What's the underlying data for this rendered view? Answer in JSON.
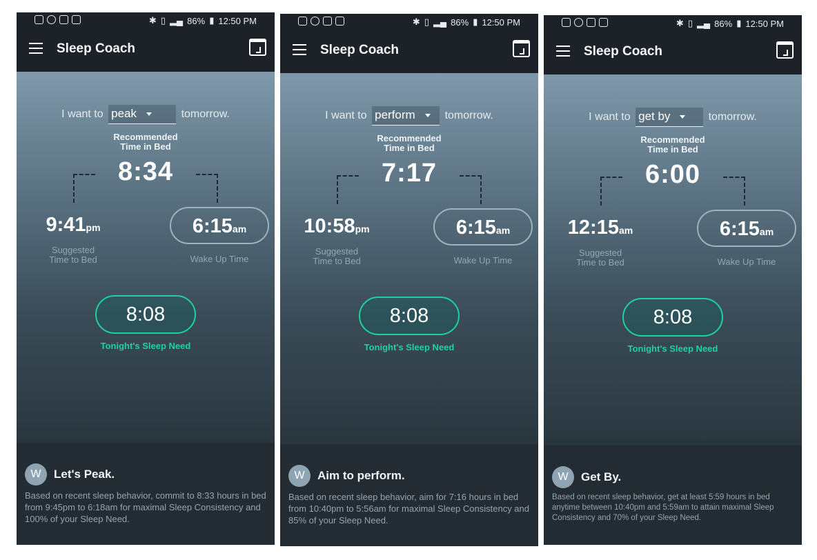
{
  "screens": [
    {
      "status": {
        "battery": "86%",
        "time": "12:50 PM"
      },
      "app_title": "Sleep Coach",
      "want_prefix": "I want to",
      "goal_selected": "peak",
      "want_suffix": "tomorrow.",
      "recommended_label_1": "Recommended",
      "recommended_label_2": "Time in Bed",
      "recommended_time": "8:34",
      "bedtime_value": "9:41",
      "bedtime_suffix": "pm",
      "bedtime_label_1": "Suggested",
      "bedtime_label_2": "Time to Bed",
      "wake_value": "6:15",
      "wake_suffix": "am",
      "wake_label": "Wake Up Time",
      "sleep_need": "8:08",
      "sleep_need_label": "Tonight's Sleep Need",
      "avatar_initial": "W",
      "message_title": "Let's Peak.",
      "message_body": "Based on recent sleep behavior, commit to 8:33 hours in bed from 9:45pm to 6:18am for maximal Sleep Consistency and 100% of your Sleep Need."
    },
    {
      "status": {
        "battery": "86%",
        "time": "12:50 PM"
      },
      "app_title": "Sleep Coach",
      "want_prefix": "I want to",
      "goal_selected": "perform",
      "want_suffix": "tomorrow.",
      "recommended_label_1": "Recommended",
      "recommended_label_2": "Time in Bed",
      "recommended_time": "7:17",
      "bedtime_value": "10:58",
      "bedtime_suffix": "pm",
      "bedtime_label_1": "Suggested",
      "bedtime_label_2": "Time to Bed",
      "wake_value": "6:15",
      "wake_suffix": "am",
      "wake_label": "Wake Up Time",
      "sleep_need": "8:08",
      "sleep_need_label": "Tonight's Sleep Need",
      "avatar_initial": "W",
      "message_title": "Aim to perform.",
      "message_body": "Based on recent sleep behavior, aim for 7:16 hours in bed from 10:40pm to 5:56am for maximal Sleep Consistency and 85% of your Sleep Need."
    },
    {
      "status": {
        "battery": "86%",
        "time": "12:50 PM"
      },
      "app_title": "Sleep Coach",
      "want_prefix": "I want to",
      "goal_selected": "get by",
      "want_suffix": "tomorrow.",
      "recommended_label_1": "Recommended",
      "recommended_label_2": "Time in Bed",
      "recommended_time": "6:00",
      "bedtime_value": "12:15",
      "bedtime_suffix": "am",
      "bedtime_label_1": "Suggested",
      "bedtime_label_2": "Time to Bed",
      "wake_value": "6:15",
      "wake_suffix": "am",
      "wake_label": "Wake Up Time",
      "sleep_need": "8:08",
      "sleep_need_label": "Tonight's Sleep Need",
      "avatar_initial": "W",
      "message_title": "Get By.",
      "message_body": "Based on recent sleep behavior, get at least 5:59 hours in bed anytime between 10:40pm and 5:59am to attain maximal Sleep Consistency and 70% of your Sleep Need."
    }
  ],
  "colors": {
    "accent_green": "#1fd1a1",
    "appbar_bg": "#1c2228",
    "footer_bg": "#242c33"
  },
  "icons": [
    "instagram-icon",
    "at-icon",
    "linkedin-icon",
    "activity-icon",
    "bluetooth-icon",
    "vibrate-icon",
    "signal-icon",
    "battery-icon",
    "menu-icon",
    "calendar-icon"
  ]
}
